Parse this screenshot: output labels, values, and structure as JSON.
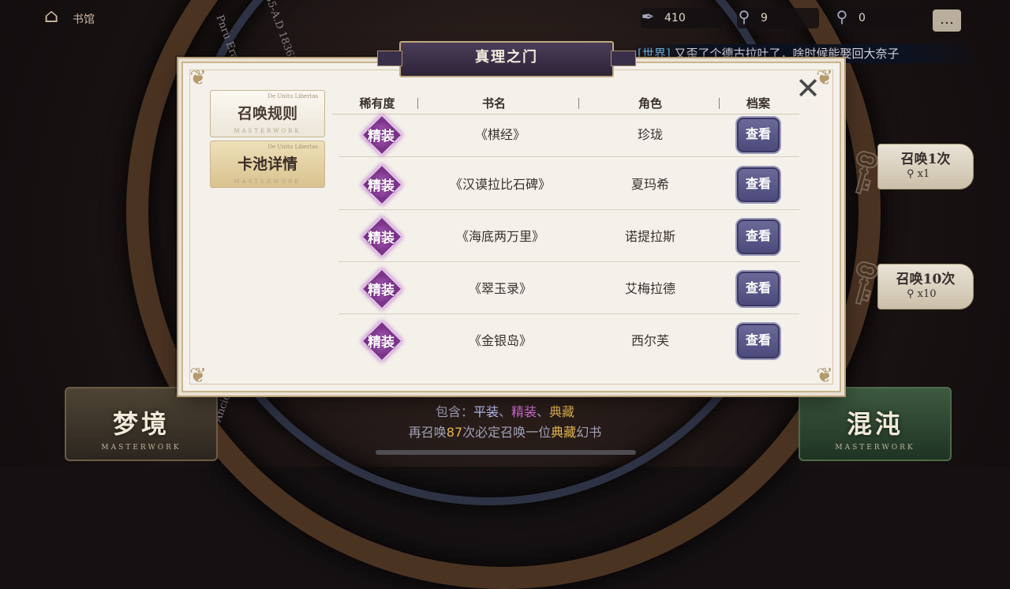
{
  "topbar": {
    "home_label": "书馆",
    "resources": [
      {
        "icon": "feather-quill-icon",
        "value": "410"
      },
      {
        "icon": "magnifier-icon",
        "value": "9"
      },
      {
        "icon": "magnifier-icon",
        "value": "0"
      }
    ],
    "chat_icon": "chat-bubble-icon"
  },
  "ticker": {
    "tag": "[世界]",
    "message": "又歪了个德古拉吐了，啥时候能娶回大奈子"
  },
  "background": {
    "ring_text_1": "Pnru Era",
    "ring_text_2": "1835-A.D 1836)",
    "ring_text_3": "Ancient Era"
  },
  "dialog": {
    "title": "真理之门",
    "tabs": [
      {
        "label": "召唤规则",
        "mini": "De Unitu Libertas",
        "sub": "MASTERWORK"
      },
      {
        "label": "卡池详情",
        "mini": "De Unitu Libertas",
        "sub": "MASTERWORK"
      }
    ],
    "table": {
      "headers": [
        "稀有度",
        "书名",
        "角色",
        "档案"
      ],
      "rows": [
        {
          "rarity": "精装",
          "book": "《棋经》",
          "role": "珍珑",
          "action": "查看"
        },
        {
          "rarity": "精装",
          "book": "《汉谟拉比石碑》",
          "role": "夏玛希",
          "action": "查看"
        },
        {
          "rarity": "精装",
          "book": "《海底两万里》",
          "role": "诺提拉斯",
          "action": "查看"
        },
        {
          "rarity": "精装",
          "book": "《翠玉录》",
          "role": "艾梅拉德",
          "action": "查看"
        },
        {
          "rarity": "精装",
          "book": "《金银岛》",
          "role": "西尔芙",
          "action": "查看"
        }
      ]
    }
  },
  "summon": {
    "once": {
      "label": "召唤1次",
      "cost": "x1"
    },
    "ten": {
      "label": "召唤10次",
      "cost": "x10"
    }
  },
  "side_buttons": {
    "left": {
      "label": "梦境",
      "sub": "MASTERWORK"
    },
    "right": {
      "label": "混沌",
      "sub": "MASTERWORK"
    }
  },
  "info": {
    "line1_prefix": "包含：",
    "tier1": "平装",
    "sep1": "、",
    "tier2": "精装",
    "sep2": "、",
    "tier3": "典藏",
    "line2_a": "再召唤",
    "line2_count": "87",
    "line2_b": "次必定召唤一位",
    "line2_tier": "典藏",
    "line2_c": "幻书"
  },
  "colors": {
    "rarity_purple": "#8a3a98",
    "view_button": "#5a5888",
    "tier_common": "#bfc8ff",
    "tier_rare": "#d870d8",
    "tier_epic": "#e4b64f"
  }
}
